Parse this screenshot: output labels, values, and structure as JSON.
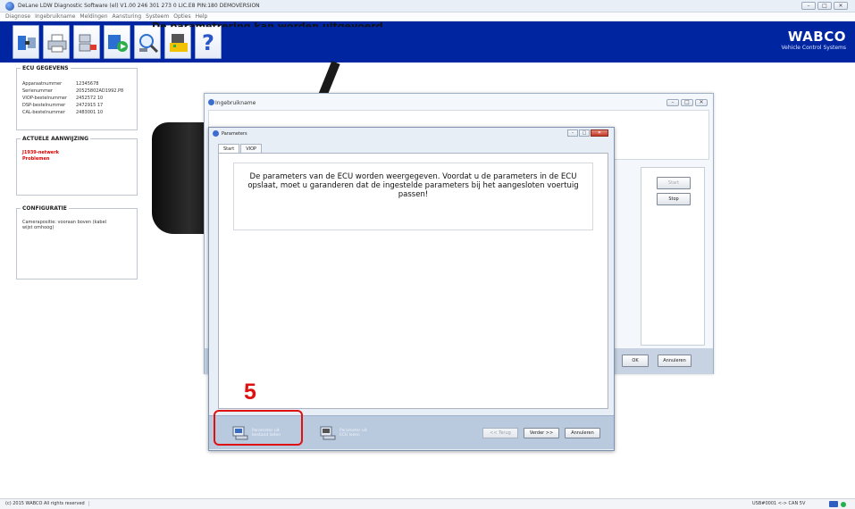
{
  "window": {
    "title": "DeLane LDW Diagnostic Software (el) V1.00  246 301 273 0  LIC.E8 PIN:180 DEMOVERSION",
    "controls": [
      "–",
      "□",
      "✕"
    ]
  },
  "menu": [
    "Diagnose",
    "Ingebruikname",
    "Meldingen",
    "Aansturing",
    "Systeem",
    "Opties",
    "Help"
  ],
  "brand": {
    "name": "WABCO",
    "tagline": "Vehicle Control Systems"
  },
  "toolbar": {
    "icons": [
      "ecu-connect-icon",
      "print-icon",
      "ecu-transfer-icon",
      "parameter-load-icon",
      "diagnosis-search-icon",
      "ecu-chip-icon",
      "help-icon"
    ],
    "help_label": "?"
  },
  "ecu_panel": {
    "header": "ECU GEGEVENS",
    "rows": [
      {
        "label": "Apparaatnummer",
        "value": "12345678"
      },
      {
        "label": "Serienummer",
        "value": "20525802AD1992.P8"
      },
      {
        "label": "VIOP-bestelnummer",
        "value": "2452572 10"
      },
      {
        "label": "DSP-bestelnummer",
        "value": "2472915 17"
      },
      {
        "label": "CAL-bestelnummer",
        "value": "2483001 10"
      }
    ]
  },
  "messages_panel": {
    "header": "ACTUELE AANWIJZING",
    "lines": [
      "J1939-netwerk",
      "Problemen"
    ]
  },
  "config_panel": {
    "header": "CONFIGURATIE",
    "text": "Camerapositie: vooraan boven (kabel wijst omhoog)"
  },
  "commissioning_window": {
    "title": "Ingebruikname",
    "heading": "De parametrering kan worden uitgevoerd",
    "start_label": "Start",
    "stop_label": "Stop",
    "ok_label": "OK",
    "cancel_label": "Annuleren"
  },
  "parameters_dialog": {
    "title": "Parameters",
    "tabs": [
      "Start",
      "VIOP"
    ],
    "message": "De parameters van de ECU worden weergegeven. Voordat u de parameters in de ECU opslaat, moet u garanderen dat de ingestelde parameters bij het aangesloten voertuig passen!",
    "footer_buttons": {
      "file_params": "Parameter uit bestand laden",
      "ecu_params": "Parameter uit ECU lezen"
    },
    "nav": {
      "back": "<< Terug",
      "next": "Verder >>",
      "cancel": "Annuleren"
    }
  },
  "annotation": {
    "callout_number": "5"
  },
  "status": {
    "copyright": "(c) 2015 WABCO All rights reserved",
    "connection": "USB#0001 <-> CAN 5V"
  }
}
